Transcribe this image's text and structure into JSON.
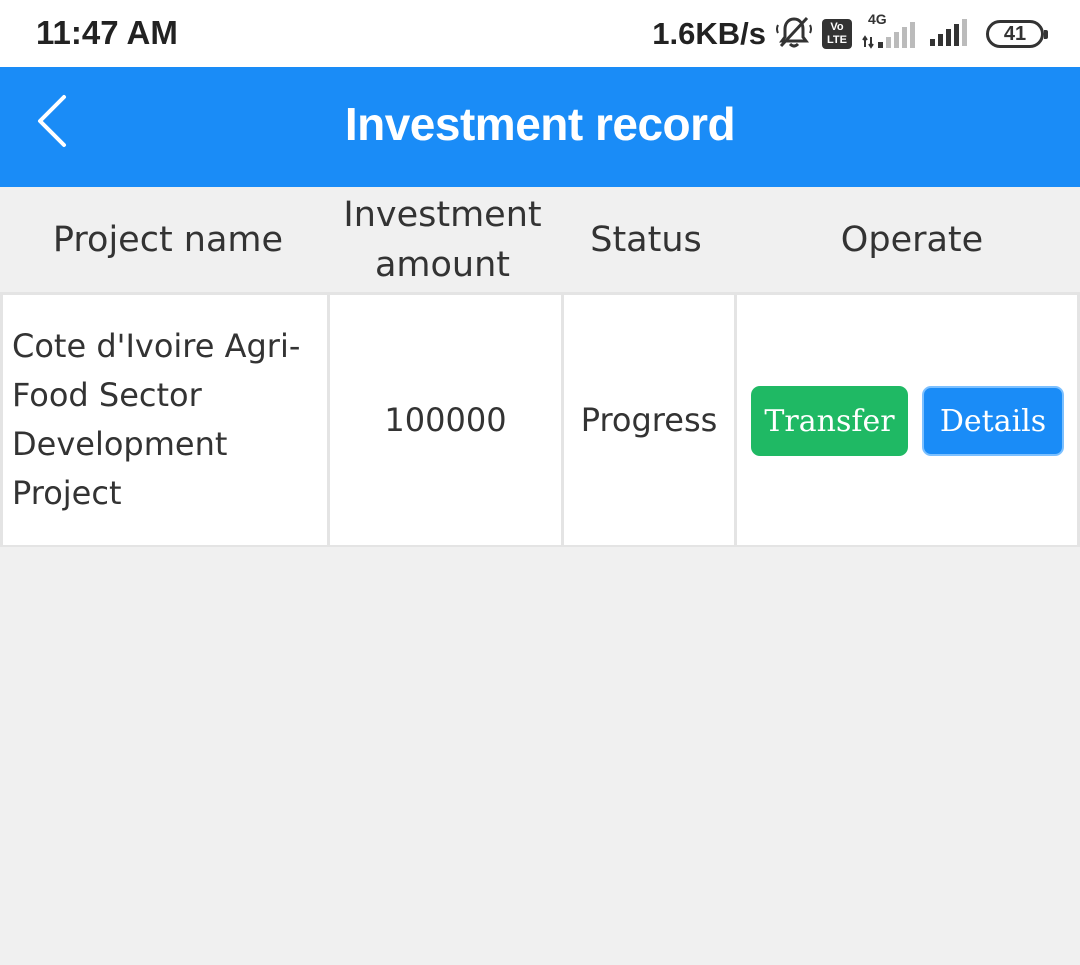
{
  "status_bar": {
    "time": "11:47 AM",
    "net_speed": "1.6KB/s",
    "volte_top": "Vo",
    "volte_bottom": "LTE",
    "network_type": "4G",
    "battery": "41"
  },
  "header": {
    "title": "Investment record",
    "back_icon": "chevron-left-icon"
  },
  "table": {
    "columns": [
      "Project name",
      "Investment amount",
      "Status",
      "Operate"
    ],
    "rows": [
      {
        "project_name": "Cote d'Ivoire Agri-Food Sector Development Project",
        "amount": "100000",
        "status": "Progress",
        "actions": {
          "transfer": "Transfer",
          "details": "Details"
        }
      }
    ]
  },
  "colors": {
    "header_blue": "#1a8cf7",
    "transfer_green": "#1fb964",
    "details_blue": "#1a8cf7",
    "background": "#f0f0f0"
  }
}
